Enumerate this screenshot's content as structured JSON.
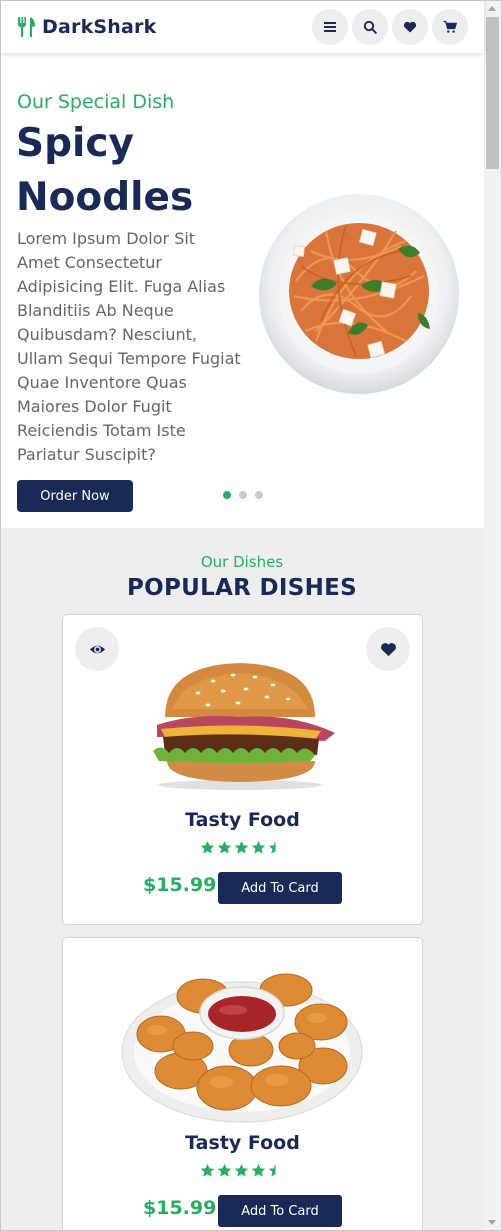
{
  "header": {
    "logo_text": "DarkShark",
    "brand_color": "#27ae60",
    "icons": [
      "menu-icon",
      "search-icon",
      "heart-icon",
      "cart-icon"
    ]
  },
  "hero": {
    "subtitle": "Our Special Dish",
    "title": "Spicy Noodles",
    "description": "Lorem Ipsum Dolor Sit Amet Consectetur Adipisicing Elit. Fuga Alias Blanditiis Ab Neque Quibusdam? Nesciunt, Ullam Sequi Tempore Fugiat Quae Inventore Quas Maiores Dolor Fugit Reiciendis Totam Iste Pariatur Suscipit?",
    "order_button": "Order Now",
    "slides_total": 3,
    "active_slide": 1
  },
  "dishes": {
    "subtitle": "Our Dishes",
    "title": "POPULAR DISHES",
    "items": [
      {
        "image": "burger",
        "name": "Tasty Food",
        "rating": 4.5,
        "price": "$15.99",
        "button": "Add To Card"
      },
      {
        "image": "chicken-nuggets",
        "name": "Tasty Food",
        "rating": 4.5,
        "price": "$15.99",
        "button": "Add To Card"
      }
    ]
  },
  "colors": {
    "primary_dark": "#192a56",
    "accent_green": "#27ae60",
    "background": "#eeeeee"
  }
}
